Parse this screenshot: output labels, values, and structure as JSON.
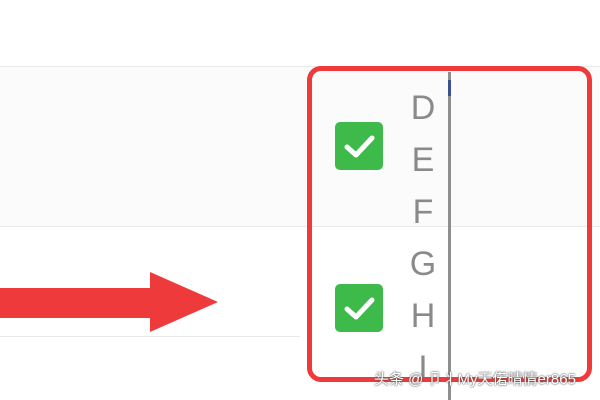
{
  "sheet": {
    "column_letters": [
      "D",
      "E",
      "F",
      "G",
      "H",
      "I"
    ],
    "checkboxes": [
      {
        "checked": true,
        "icon": "check-icon"
      },
      {
        "checked": true,
        "icon": "check-icon"
      }
    ]
  },
  "colors": {
    "highlight": "#ee3a3a",
    "checkbox": "#3dba49",
    "arrow": "#ee3a3a",
    "letters": "#8a8a8a"
  },
  "annotation": {
    "arrow_icon": "arrow-right-icon"
  },
  "watermark": {
    "text": "头条 @ 卩丬My天偌晴情er865"
  }
}
